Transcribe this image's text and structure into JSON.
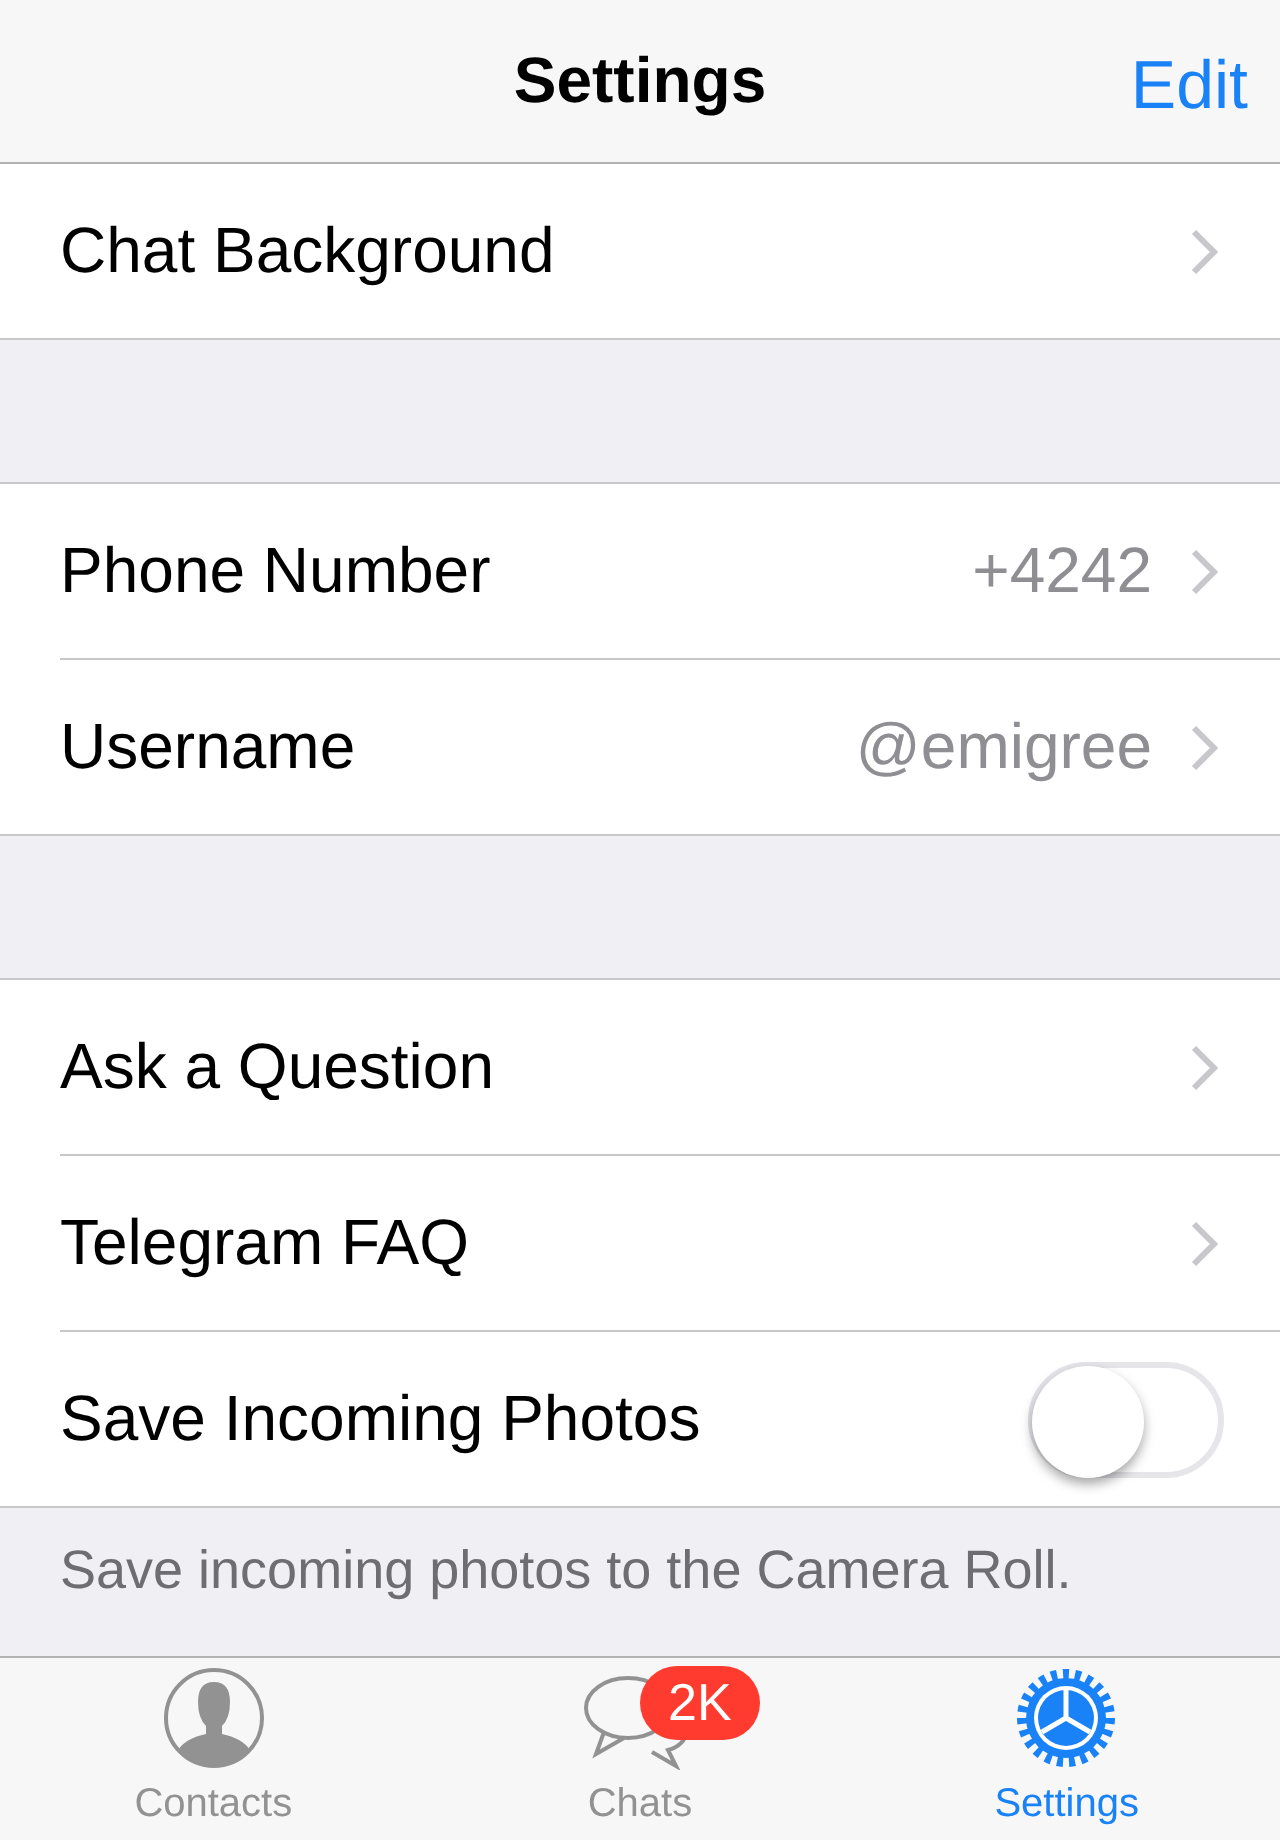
{
  "nav_bar": {
    "title": "Settings",
    "action": "Edit"
  },
  "groups": [
    {
      "rows": [
        {
          "kind": "link",
          "label": "Chat Background"
        }
      ]
    },
    {
      "rows": [
        {
          "kind": "link",
          "label": "Phone Number",
          "value": "+4242"
        },
        {
          "kind": "link",
          "label": "Username",
          "value": "@emigree"
        }
      ]
    },
    {
      "rows": [
        {
          "kind": "link",
          "label": "Ask a Question"
        },
        {
          "kind": "link",
          "label": "Telegram FAQ"
        },
        {
          "kind": "toggle",
          "label": "Save Incoming Photos",
          "on": false
        }
      ],
      "footer": "Save incoming photos to the Camera Roll."
    }
  ],
  "tab_bar": [
    {
      "kind": "contacts",
      "label": "Contacts",
      "selected": false
    },
    {
      "kind": "chats",
      "label": "Chats",
      "badge": "2K",
      "selected": false
    },
    {
      "kind": "settings",
      "label": "Settings",
      "selected": true
    }
  ]
}
